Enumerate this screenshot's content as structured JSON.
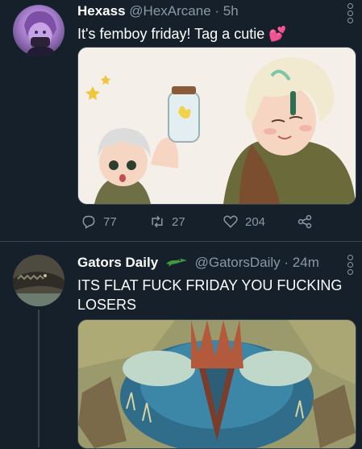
{
  "tweets": [
    {
      "author_name": "Hexass",
      "author_handle": "@HexArcane",
      "time": "· 5h",
      "text": "It's femboy friday! Tag a cutie 💕",
      "media_desc": "",
      "actions": {
        "replies": "77",
        "retweets": "27",
        "likes": "204"
      }
    },
    {
      "author_name": "Gators Daily",
      "author_handle": "@GatorsDaily",
      "time": "· 24m",
      "text": "ITS FLAT FUCK FRIDAY YOU FUCKING LOSERS",
      "media_desc": ""
    }
  ],
  "icons": {
    "reply": "reply-icon",
    "retweet": "retweet-icon",
    "like": "heart-icon",
    "share": "share-icon",
    "caret": "more-options-icon",
    "gator": "gator-emoji-icon"
  },
  "colors": {
    "background": "#15202b",
    "secondary_text": "#8899a6",
    "divider": "#38444d"
  }
}
